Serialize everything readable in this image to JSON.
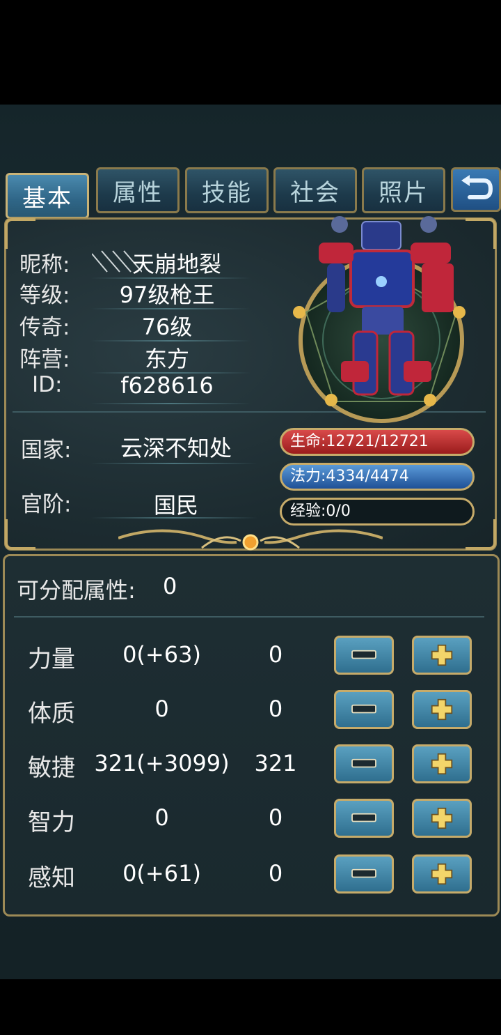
{
  "tabs": [
    {
      "label": "基本",
      "active": true
    },
    {
      "label": "属性",
      "active": false
    },
    {
      "label": "技能",
      "active": false
    },
    {
      "label": "社会",
      "active": false
    },
    {
      "label": "照片",
      "active": false
    }
  ],
  "back_icon": "return-arrow-icon",
  "profile": {
    "nickname_label": "昵称:",
    "nickname_value": "天崩地裂",
    "level_label": "等级:",
    "level_value": "97级枪王",
    "legend_label": "传奇:",
    "legend_value": "76级",
    "camp_label": "阵营:",
    "camp_value": "东方",
    "id_label": "ID:",
    "id_value": "f628616",
    "country_label": "国家:",
    "country_value": "云深不知处",
    "rank_label": "官阶:",
    "rank_value": "国民"
  },
  "bars": {
    "hp": "生命:12721/12721",
    "mp": "法力:4334/4474",
    "exp": "经验:0/0",
    "hp_fraction": 1.0,
    "mp_fraction": 0.969,
    "exp_fraction": 0
  },
  "allocation": {
    "label": "可分配属性:",
    "value": "0"
  },
  "stats": [
    {
      "name": "力量",
      "base": "0(+63)",
      "alloc": "0"
    },
    {
      "name": "体质",
      "base": "0",
      "alloc": "0"
    },
    {
      "name": "敏捷",
      "base": "321(+3099)",
      "alloc": "321"
    },
    {
      "name": "智力",
      "base": "0",
      "alloc": "0"
    },
    {
      "name": "感知",
      "base": "0(+61)",
      "alloc": "0"
    }
  ],
  "colors": {
    "gold_border": "#c6ab6a",
    "hp_red": "#c03030",
    "mp_blue": "#3a78c0",
    "tab_active": "#3d7aa0"
  }
}
